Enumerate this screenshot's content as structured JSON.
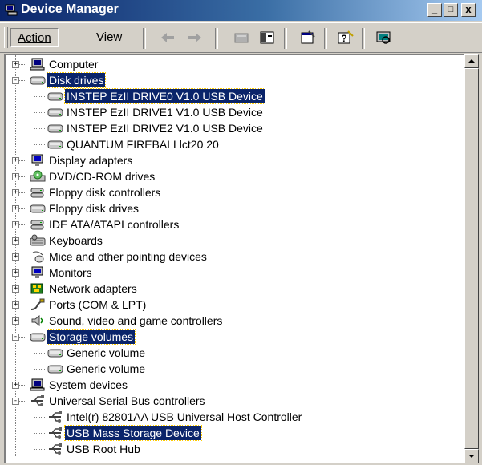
{
  "window": {
    "title": "Device Manager",
    "min": "_",
    "max": "□",
    "close": "x"
  },
  "toolbar": {
    "action_label": "Action",
    "view_label": "View"
  },
  "tree": [
    {
      "label": "Computer",
      "level": 0,
      "expander": "+",
      "icon": "computer-icon"
    },
    {
      "label": "Disk drives",
      "level": 0,
      "expander": "−",
      "icon": "disk-drive-icon",
      "selected": true
    },
    {
      "label": "INSTEP EzII DRIVE0 V1.0 USB Device",
      "level": 1,
      "icon": "disk-drive-icon",
      "selected": true
    },
    {
      "label": "INSTEP EzII DRIVE1 V1.0 USB Device",
      "level": 1,
      "icon": "disk-drive-icon"
    },
    {
      "label": "INSTEP EzII DRIVE2 V1.0 USB Device",
      "level": 1,
      "icon": "disk-drive-icon"
    },
    {
      "label": "QUANTUM FIREBALLlct20 20",
      "level": 1,
      "icon": "disk-drive-icon"
    },
    {
      "label": "Display adapters",
      "level": 0,
      "expander": "+",
      "icon": "monitor-icon"
    },
    {
      "label": "DVD/CD-ROM drives",
      "level": 0,
      "expander": "+",
      "icon": "cdrom-icon"
    },
    {
      "label": "Floppy disk controllers",
      "level": 0,
      "expander": "+",
      "icon": "controller-icon"
    },
    {
      "label": "Floppy disk drives",
      "level": 0,
      "expander": "+",
      "icon": "disk-drive-icon"
    },
    {
      "label": "IDE ATA/ATAPI controllers",
      "level": 0,
      "expander": "+",
      "icon": "controller-icon"
    },
    {
      "label": "Keyboards",
      "level": 0,
      "expander": "+",
      "icon": "keyboard-icon"
    },
    {
      "label": "Mice and other pointing devices",
      "level": 0,
      "expander": "+",
      "icon": "mouse-icon"
    },
    {
      "label": "Monitors",
      "level": 0,
      "expander": "+",
      "icon": "monitor-icon"
    },
    {
      "label": "Network adapters",
      "level": 0,
      "expander": "+",
      "icon": "network-icon"
    },
    {
      "label": "Ports (COM & LPT)",
      "level": 0,
      "expander": "+",
      "icon": "port-icon"
    },
    {
      "label": "Sound, video and game controllers",
      "level": 0,
      "expander": "+",
      "icon": "sound-icon"
    },
    {
      "label": "Storage volumes",
      "level": 0,
      "expander": "−",
      "icon": "disk-drive-icon",
      "selected": true
    },
    {
      "label": "Generic volume",
      "level": 1,
      "icon": "disk-drive-icon"
    },
    {
      "label": "Generic volume",
      "level": 1,
      "icon": "disk-drive-icon"
    },
    {
      "label": "System devices",
      "level": 0,
      "expander": "+",
      "icon": "computer-icon"
    },
    {
      "label": "Universal Serial Bus controllers",
      "level": 0,
      "expander": "−",
      "icon": "usb-icon"
    },
    {
      "label": "Intel(r) 82801AA USB Universal Host Controller",
      "level": 1,
      "icon": "usb-icon"
    },
    {
      "label": "USB Mass Storage Device",
      "level": 1,
      "icon": "usb-icon",
      "selected": true
    },
    {
      "label": "USB Root Hub",
      "level": 1,
      "icon": "usb-icon"
    }
  ]
}
